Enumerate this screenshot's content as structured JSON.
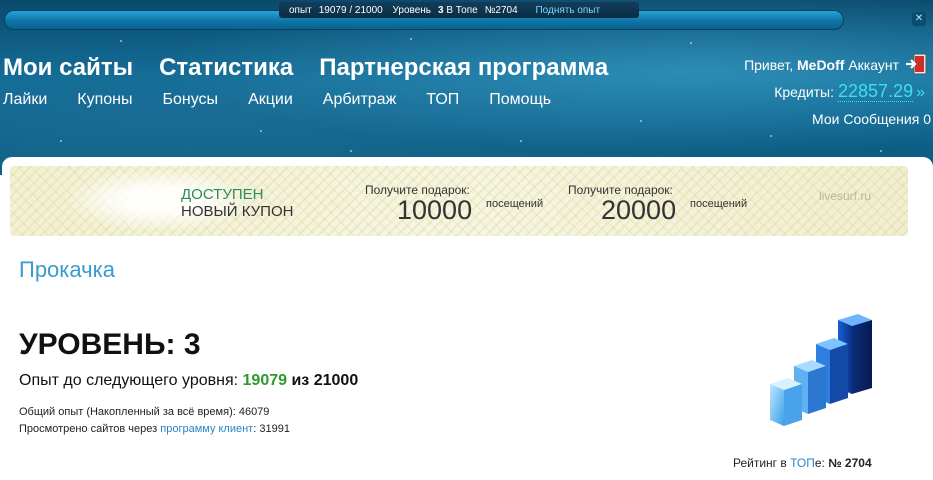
{
  "topbar": {
    "xp_label": "опыт",
    "xp_value": "19079 / 21000",
    "level_label": "Уровень",
    "level_value": "3",
    "top_label": "В Топе",
    "top_value": "№2704",
    "raise_link": "Поднять опыт",
    "progress_fraction": 0.9085
  },
  "nav": {
    "main": [
      "Мои сайты",
      "Статистика",
      "Партнерская программа"
    ],
    "sub": [
      "Лайки",
      "Купоны",
      "Бонусы",
      "Акции",
      "Арбитраж",
      "ТОП",
      "Помощь"
    ]
  },
  "user": {
    "greeting": "Привет,",
    "name": "MeDoff",
    "account_link": "Аккаунт",
    "credits_label": "Кредиты:",
    "credits_value": "22857.29",
    "messages": "Мои Сообщения 0"
  },
  "banner": {
    "available": "ДОСТУПЕН",
    "coupon": "НОВЫЙ КУПОН",
    "gift1_label": "Получите подарок:",
    "gift1_value": "10000",
    "gift1_unit": "посещений",
    "gift2_label": "Получите подарок:",
    "gift2_value": "20000",
    "gift2_unit": "посещений",
    "brand": "livesurf.ru"
  },
  "page": {
    "title": "Прокачка",
    "level": "УРОВЕНЬ: 3",
    "next_level_label": "Опыт до следующего уровня:",
    "next_level_current": "19079",
    "next_level_of": "из",
    "next_level_max": "21000",
    "total_xp": "Общий опыт (Накопленный за всё время): 46079",
    "viewed_prefix": "Просмотрено сайтов через",
    "viewed_link": "программу клиент",
    "viewed_value": ": 31991",
    "rating_prefix": "Рейтинг в",
    "rating_link": "ТОП",
    "rating_sep": "е:",
    "rating_value": "№ 2704"
  },
  "icons": {
    "logout": "logout-door-icon",
    "close": "close-icon",
    "credits_arrow": "double-chevron-right-icon",
    "level_graphic": "bar-chart-3d-icon"
  },
  "colors": {
    "header_blue": "#0f6a94",
    "link_blue": "#2a86c4",
    "title_blue": "#3a9bcf",
    "credits_cyan": "#3fe0e6",
    "progress_green": "#2e9a2e",
    "coupon_green": "#2a8d5a"
  }
}
